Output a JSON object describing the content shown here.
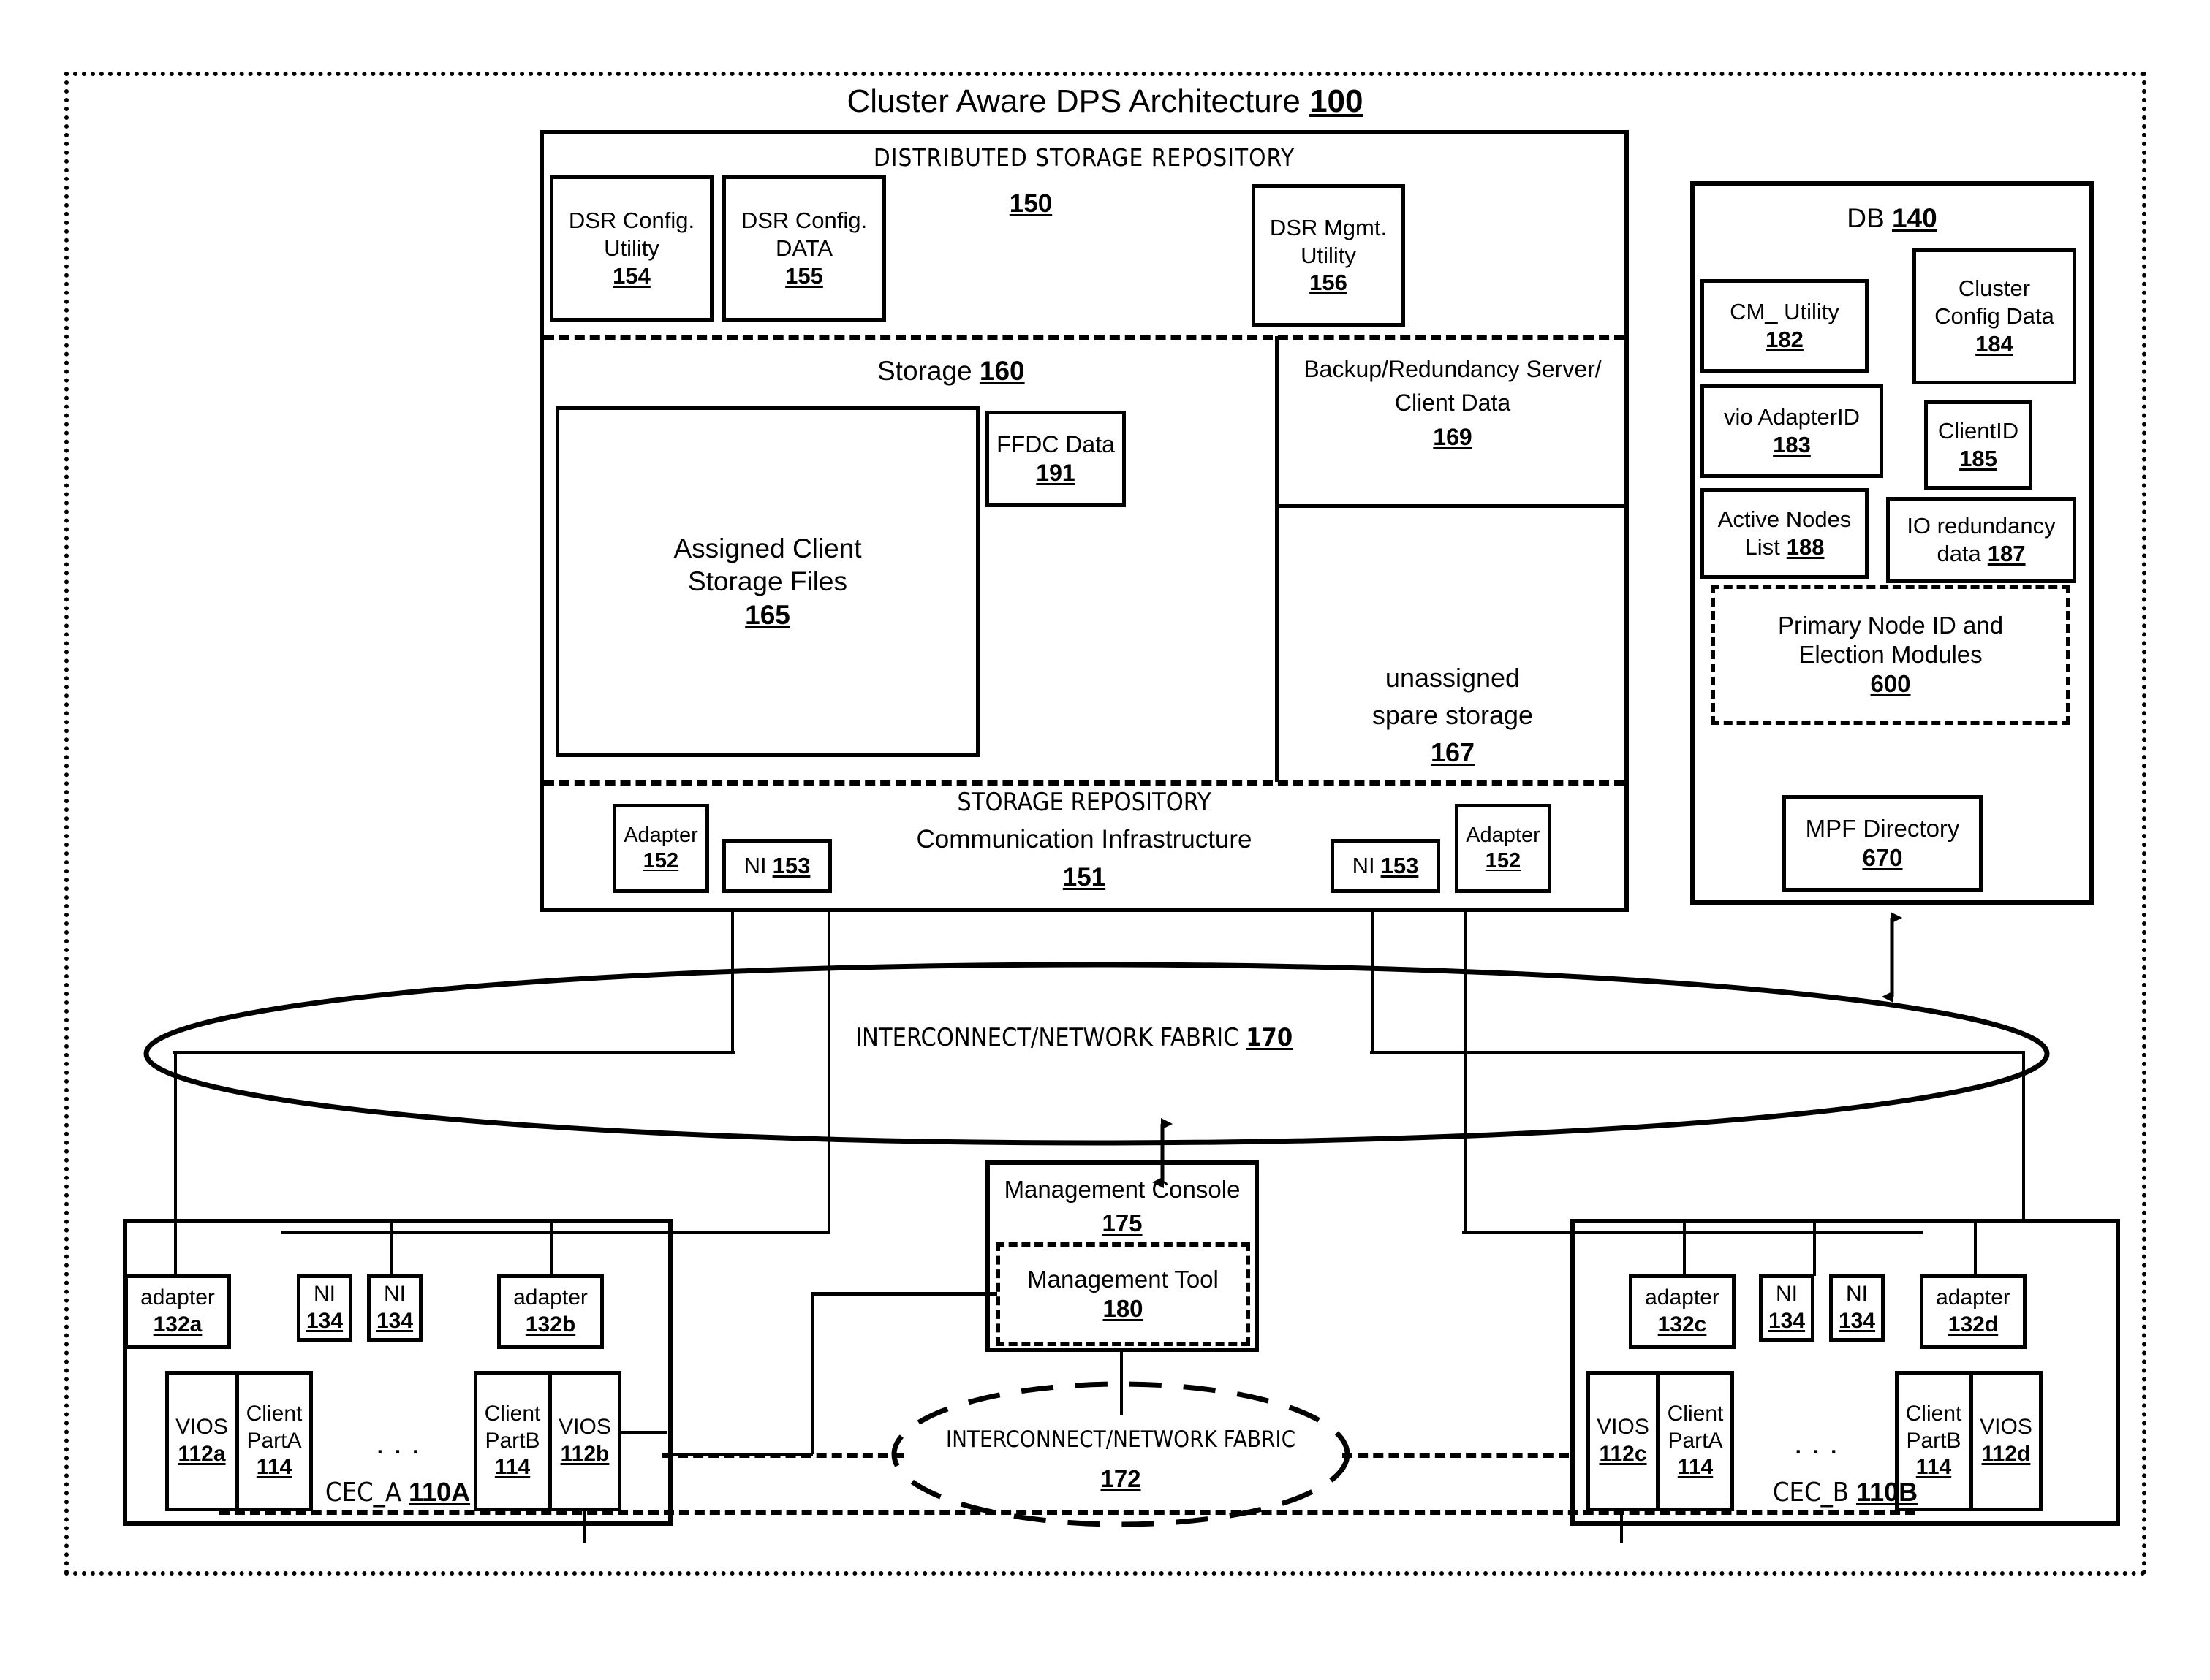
{
  "figure": {
    "title": "Cluster Aware DPS Architecture",
    "title_ref": "100"
  },
  "dsr": {
    "heading": "DISTRIBUTED STORAGE REPOSITORY",
    "ref": "150",
    "boxes": [
      {
        "line1": "DSR Config.",
        "line2": "Utility",
        "ref": "154"
      },
      {
        "line1": "DSR Config.",
        "line2": "DATA",
        "ref": "155"
      },
      {
        "line1": "DSR Mgmt.",
        "line2": "Utility",
        "ref": "156"
      }
    ],
    "storage": {
      "label": "Storage",
      "ref": "160",
      "assigned": {
        "line1": "Assigned Client",
        "line2": "Storage Files",
        "ref": "165"
      },
      "ffdc": {
        "line1": "FFDC Data",
        "ref": "191"
      },
      "backup": {
        "line1": "Backup/Redundancy Server/",
        "line2": "Client Data",
        "ref": "169"
      },
      "spare": {
        "line1": "unassigned",
        "line2": "spare storage",
        "ref": "167"
      }
    },
    "comm": {
      "line1": "STORAGE REPOSITORY",
      "line2": "Communication Infrastructure",
      "ref": "151",
      "adapter_left": {
        "label": "Adapter",
        "ref": "152"
      },
      "ni_left": {
        "label": "NI",
        "ref": "153"
      },
      "ni_right": {
        "label": "NI",
        "ref": "153"
      },
      "adapter_right": {
        "label": "Adapter",
        "ref": "152"
      }
    }
  },
  "db": {
    "label": "DB",
    "ref": "140",
    "items": [
      {
        "line1": "CM_ Utility",
        "ref": "182"
      },
      {
        "line1": "Cluster",
        "line2": "Config Data",
        "ref": "184"
      },
      {
        "line1": "vio AdapterID",
        "ref": "183"
      },
      {
        "line1": "ClientID",
        "ref": "185"
      },
      {
        "line1": "Active Nodes",
        "line2_prefix": "List",
        "ref": "188"
      },
      {
        "line1": "IO redundancy",
        "line2_prefix": "data",
        "ref": "187"
      }
    ],
    "election": {
      "line1": "Primary Node ID and",
      "line2": "Election Modules",
      "ref": "600"
    },
    "mpf": {
      "line1": "MPF Directory",
      "ref": "670"
    }
  },
  "fabric_top": {
    "label": "INTERCONNECT/NETWORK  FABRIC",
    "ref": "170"
  },
  "fabric_bottom": {
    "label": "INTERCONNECT/NETWORK  FABRIC",
    "ref": "172"
  },
  "management": {
    "console": {
      "label": "Management Console",
      "ref": "175"
    },
    "tool": {
      "label": "Management Tool",
      "ref": "180"
    }
  },
  "cec_a": {
    "label": "CEC_A",
    "ref": "110A",
    "adapter_left": {
      "label": "adapter",
      "ref": "132a"
    },
    "ni_1": {
      "label": "NI",
      "ref": "134"
    },
    "ni_2": {
      "label": "NI",
      "ref": "134"
    },
    "adapter_right": {
      "label": "adapter",
      "ref": "132b"
    },
    "vios_left": {
      "label": "VIOS",
      "ref": "112a"
    },
    "client_a": {
      "line1": "Client",
      "line2": "PartA",
      "ref": "114"
    },
    "ellipsis": "...",
    "client_b": {
      "line1": "Client",
      "line2": "PartB",
      "ref": "114"
    },
    "vios_right": {
      "label": "VIOS",
      "ref": "112b"
    }
  },
  "cec_b": {
    "label": "CEC_B",
    "ref": "110B",
    "adapter_left": {
      "label": "adapter",
      "ref": "132c"
    },
    "ni_1": {
      "label": "NI",
      "ref": "134"
    },
    "ni_2": {
      "label": "NI",
      "ref": "134"
    },
    "adapter_right": {
      "label": "adapter",
      "ref": "132d"
    },
    "vios_left": {
      "label": "VIOS",
      "ref": "112c"
    },
    "client_a": {
      "line1": "Client",
      "line2": "PartA",
      "ref": "114"
    },
    "ellipsis": "...",
    "client_b": {
      "line1": "Client",
      "line2": "PartB",
      "ref": "114"
    },
    "vios_right": {
      "label": "VIOS",
      "ref": "112d"
    }
  }
}
